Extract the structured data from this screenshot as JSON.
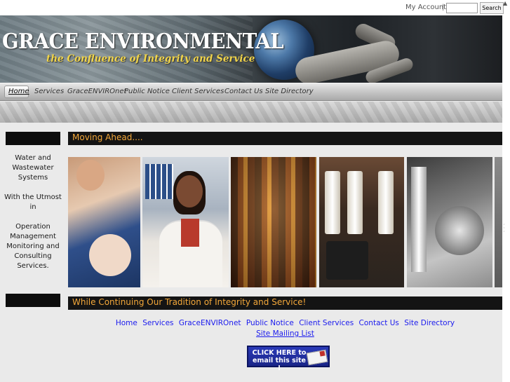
{
  "topbar": {
    "account_label": "My Account",
    "separator": "|",
    "search_placeholder": "",
    "search_button": "Search"
  },
  "banner": {
    "title": "GRACE ENVIRONMENTAL",
    "tagline": "the Confluence of Integrity and Service"
  },
  "nav": {
    "items": [
      "Home",
      "Services",
      "GraceENVIROnet",
      "Public Notice",
      "Client Services",
      "Contact Us",
      "Site Directory"
    ],
    "active": "Home"
  },
  "sidebar": {
    "text1": "Water and Wastewater Systems",
    "text2": "With the Utmost in",
    "text3": "Operation Management Monitoring and Consulting Services."
  },
  "main": {
    "heading1": "Moving Ahead....",
    "heading2": "While Continuing Our Tradition of Integrity and Service!"
  },
  "footer": {
    "links": [
      "Home",
      "Services",
      "GraceENVIROnet",
      "Public Notice",
      "Client Services",
      "Contact Us",
      "Site Directory"
    ],
    "mailing_list": "Site Mailing List"
  },
  "email_button": {
    "line1": "CLICK HERE to",
    "line2": "email this site !"
  },
  "colors": {
    "heading_text": "#f4a83a",
    "link": "#1a1aee",
    "header_bar": "#141414"
  }
}
